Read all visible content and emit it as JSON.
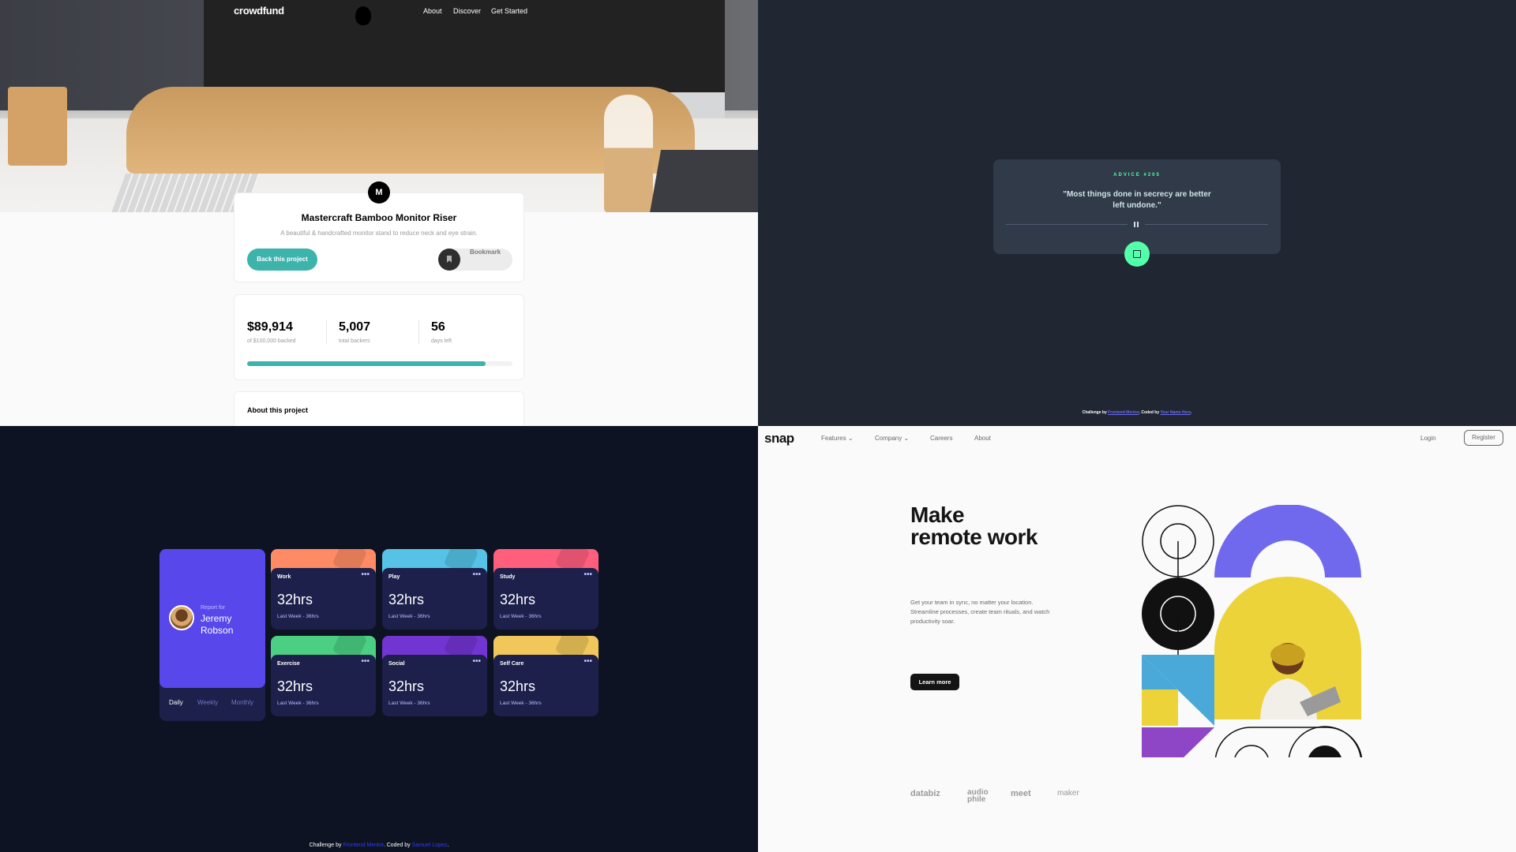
{
  "crowdfund": {
    "logo": "crowdfund",
    "nav": [
      "About",
      "Discover",
      "Get Started"
    ],
    "badge": "M",
    "title": "Mastercraft Bamboo Monitor Riser",
    "description": "A beautiful & handcrafted monitor stand to reduce neck and eye strain.",
    "back_button": "Back this project",
    "bookmark_label": "Bookmark",
    "stats": [
      {
        "value": "$89,914",
        "label": "of $100,000 backed"
      },
      {
        "value": "5,007",
        "label": "total backers"
      },
      {
        "value": "56",
        "label": "days left"
      }
    ],
    "progress_fraction": 0.8991,
    "about_title": "About this project",
    "colors": {
      "accent": "#3cb3ab",
      "dark": "#2f2f2f"
    }
  },
  "advice": {
    "label": "ADVICE #205",
    "quote": "\"Most things done in secrecy are better left undone.\"",
    "dice_icon": "dice-icon",
    "attribution_prefix": "Challenge by",
    "attribution_link1": "Frontend Mentor",
    "attribution_mid": ". Coded by",
    "attribution_link2": "Your Name Here",
    "attribution_suffix": ".",
    "colors": {
      "accent": "#53ffaa",
      "card": "#313a48"
    }
  },
  "tracker": {
    "report_for": "Report for",
    "name": "Jeremy Robson",
    "tabs": [
      "Daily",
      "Weekly",
      "Monthly"
    ],
    "active_tab": "Daily",
    "cards": [
      {
        "title": "Work",
        "hours": "32hrs",
        "previous": "Last Week - 36hrs",
        "color": "#ff8b64"
      },
      {
        "title": "Play",
        "hours": "32hrs",
        "previous": "Last Week - 36hrs",
        "color": "#55c2e6"
      },
      {
        "title": "Study",
        "hours": "32hrs",
        "previous": "Last Week - 36hrs",
        "color": "#ff5e7d"
      },
      {
        "title": "Exercise",
        "hours": "32hrs",
        "previous": "Last Week - 36hrs",
        "color": "#4bcf82"
      },
      {
        "title": "Social",
        "hours": "32hrs",
        "previous": "Last Week - 36hrs",
        "color": "#7335d2"
      },
      {
        "title": "Self Care",
        "hours": "32hrs",
        "previous": "Last Week - 36hrs",
        "color": "#f1c75b"
      }
    ],
    "dots": "•••",
    "attribution_prefix": "Challenge by",
    "attribution_link1": "Frontend Mentor",
    "attribution_mid": ". Coded by",
    "attribution_link2": "Samuel Lopez",
    "attribution_suffix": "."
  },
  "snap": {
    "logo": "snap",
    "nav": [
      "Features",
      "Company",
      "Careers",
      "About"
    ],
    "login": "Login",
    "register": "Register",
    "headline_line1": "Make",
    "headline_line2": "remote work",
    "paragraph": "Get your team in sync, no matter your location. Streamline processes, create team rituals, and watch productivity soar.",
    "cta": "Learn more",
    "clients": [
      "databiz",
      "audio phile",
      "meet",
      "maker"
    ]
  }
}
